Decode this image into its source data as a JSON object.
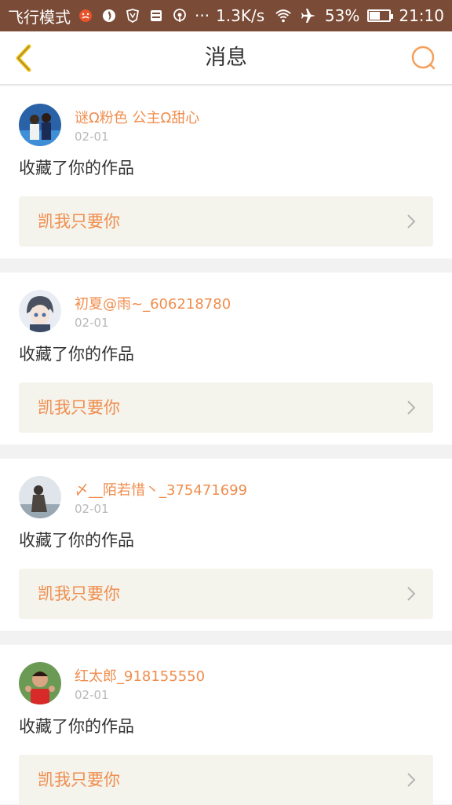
{
  "status_bar": {
    "airplane_mode": "飞行模式",
    "more": "···",
    "speed": "1.3K/s",
    "battery_percent": "53%",
    "battery_level": 0.53,
    "time": "21:10"
  },
  "header": {
    "title": "消息"
  },
  "messages": [
    {
      "user": "谜Ω粉色 公主Ω甜心",
      "date": "02-01",
      "action": "收藏了你的作品",
      "work": "凯我只要你"
    },
    {
      "user": "初夏@雨~_606218780",
      "date": "02-01",
      "action": "收藏了你的作品",
      "work": "凯我只要你"
    },
    {
      "user": "〆__陌若惜丶_375471699",
      "date": "02-01",
      "action": "收藏了你的作品",
      "work": "凯我只要你"
    },
    {
      "user": "红太郎_918155550",
      "date": "02-01",
      "action": "收藏了你的作品",
      "work": "凯我只要你"
    }
  ],
  "colors": {
    "accent": "#f08d4d",
    "back_arrow": "#f5c518",
    "status_bar": "#7a4b36",
    "work_box": "#f4f3ec"
  }
}
